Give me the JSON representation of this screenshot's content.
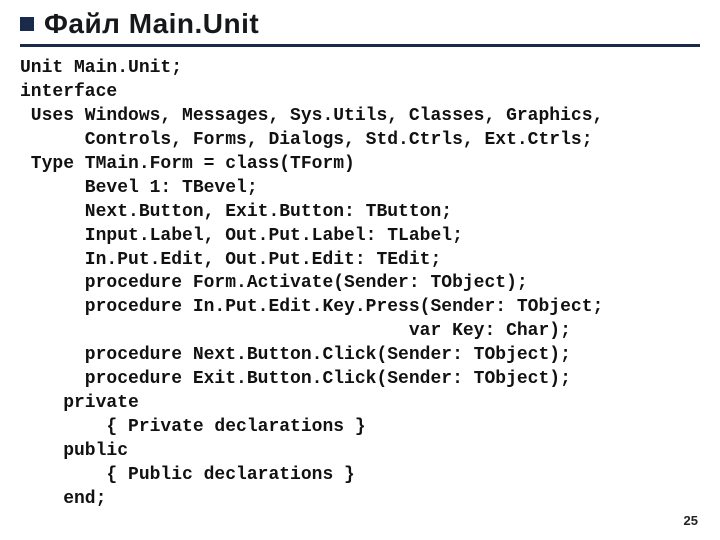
{
  "title": "Файл Main.Unit",
  "page_number": "25",
  "code_lines": [
    "Unit Main.Unit;",
    "interface",
    " Uses Windows, Messages, Sys.Utils, Classes, Graphics,",
    "      Controls, Forms, Dialogs, Std.Ctrls, Ext.Ctrls;",
    " Type TMain.Form = class(TForm)",
    "      Bevel 1: TBevel;",
    "      Next.Button, Exit.Button: TButton;",
    "      Input.Label, Out.Put.Label: TLabel;",
    "      In.Put.Edit, Out.Put.Edit: TEdit;",
    "      procedure Form.Activate(Sender: TObject);",
    "      procedure In.Put.Edit.Key.Press(Sender: TObject;",
    "                                    var Key: Char);",
    "      procedure Next.Button.Click(Sender: TObject);",
    "      procedure Exit.Button.Click(Sender: TObject);",
    "    private",
    "        { Private declarations }",
    "    public",
    "        { Public declarations }",
    "    end;"
  ]
}
